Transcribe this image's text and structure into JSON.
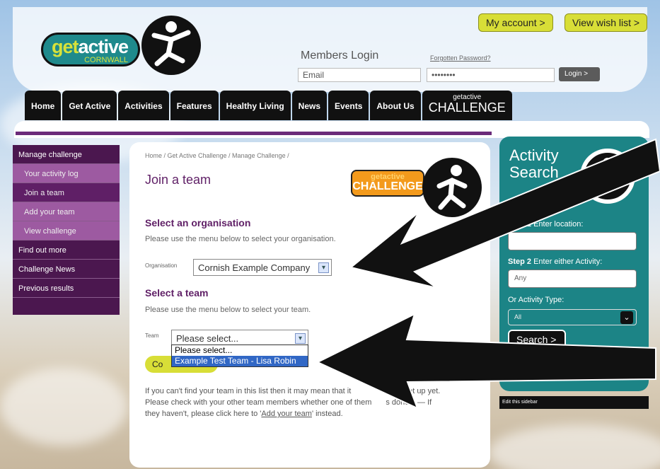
{
  "header": {
    "logo_get": "get",
    "logo_active": "active",
    "logo_region": "CORNWALL",
    "account_button": "My account  >",
    "wishlist_button": "View wish list  >",
    "members_login": "Members Login",
    "forgot_password": "Forgotten Password?",
    "email_placeholder": "Email",
    "password_value": "••••••••",
    "login_button": "Login  >"
  },
  "nav": {
    "items": [
      "Home",
      "Get Active",
      "Activities",
      "Features",
      "Healthy Living",
      "News",
      "Events",
      "About Us"
    ],
    "challenge_small": "getactive",
    "challenge_big": "CHALLENGE"
  },
  "sidebar": {
    "items": [
      "Manage challenge",
      "Your activity log",
      "Join a team",
      "Add your team",
      "View challenge",
      "Find out more",
      "Challenge News",
      "Previous results"
    ]
  },
  "main": {
    "breadcrumb": "Home / Get Active Challenge / Manage Challenge /",
    "title": "Join a team",
    "badge_small": "getactive",
    "badge_big": "CHALLENGE",
    "org_heading": "Select an organisation",
    "org_text": "Please use the menu below to select your organisation.",
    "org_label": "Organisation",
    "org_value": "Cornish Example Company",
    "team_heading": "Select a team",
    "team_text": "Please use the menu below to select your team.",
    "team_label": "Team",
    "team_value": "Please select...",
    "dropdown_options": [
      "Please select...",
      "Example Test Team - Lisa Robin"
    ],
    "continue_button": "Co",
    "footer_line1": "If you can't find your team in this list then it may mean that it",
    "footer_line1_end": "en set up yet.",
    "footer_line2": "Please check with your other team members whether one of them",
    "footer_line2_end": "s done it — If",
    "footer_line3": "they haven't, please click here to '",
    "footer_link": "Add your team",
    "footer_line3_end": "' instead."
  },
  "activity_search": {
    "title_line1": "Activity",
    "title_line2": "Search",
    "step1_a": "Step 1",
    "step1_b": "Enter location:",
    "step2_a": "Step 2",
    "step2_b": "Enter either Activity:",
    "activity_placeholder": "Any",
    "or_type": "Or Activity Type:",
    "type_value": "All",
    "search_button": "Search  >",
    "edit_sidebar": "Edit this sidebar"
  }
}
